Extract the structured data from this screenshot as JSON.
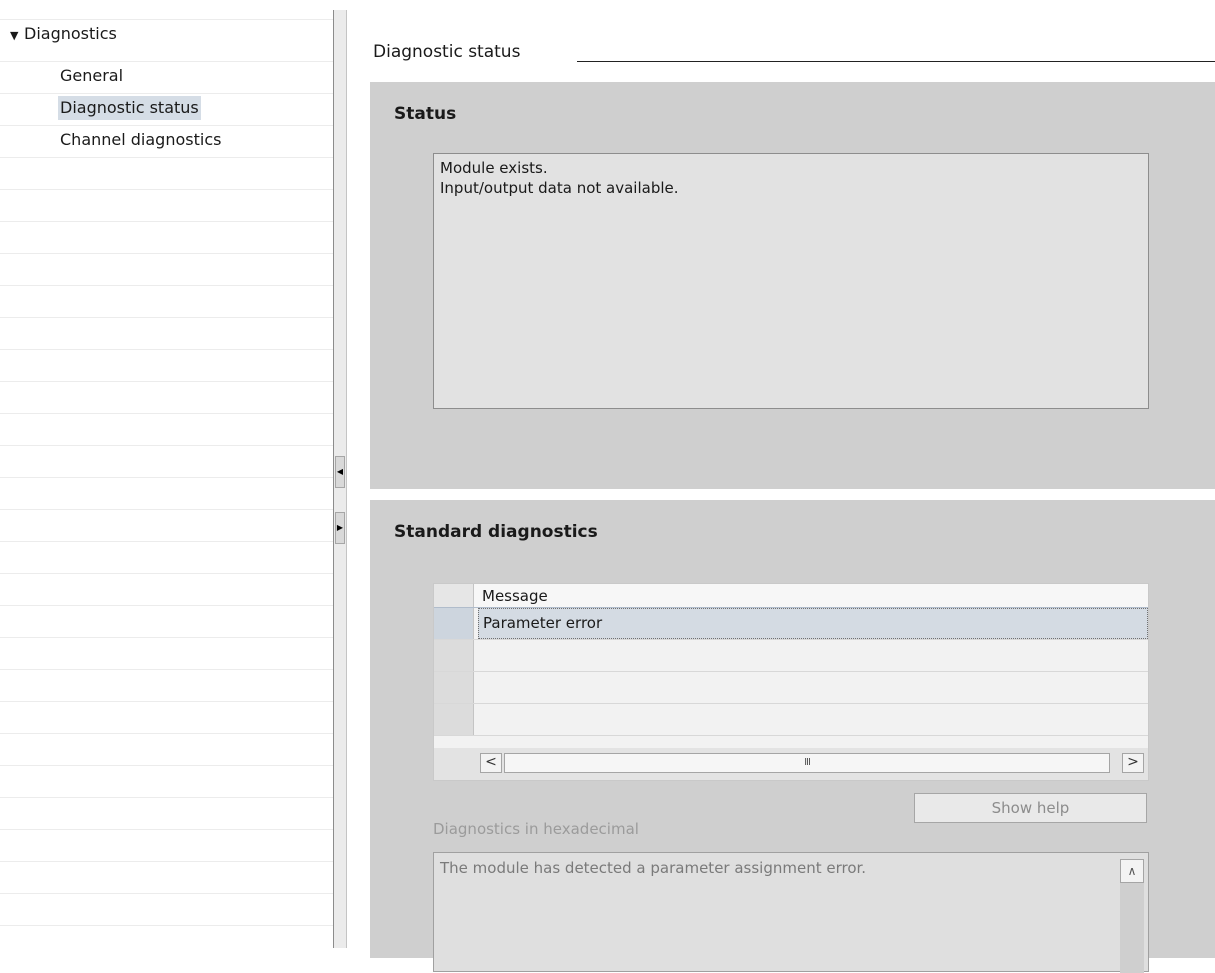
{
  "navigation": {
    "root_label": "Diagnostics",
    "items": [
      {
        "label": "General",
        "selected": false
      },
      {
        "label": "Diagnostic status",
        "selected": true
      },
      {
        "label": "Channel diagnostics",
        "selected": false
      }
    ]
  },
  "section": {
    "title": "Diagnostic status"
  },
  "status_panel": {
    "title": "Status",
    "lines": [
      "Module exists.",
      "Input/output data not available."
    ]
  },
  "standard_panel": {
    "title": "Standard diagnostics",
    "table": {
      "column_header": "Message",
      "rows": [
        "Parameter error",
        "",
        "",
        ""
      ]
    },
    "scroll_thumb_glyph": "III",
    "show_help_label": "Show help",
    "hex_label": "Diagnostics in hexadecimal",
    "hex_text": "The module has detected a parameter assignment error."
  },
  "icons": {
    "expand": "caret-down-icon",
    "collapse_left": "arrow-left-icon",
    "collapse_right": "arrow-right-icon",
    "scroll_left": "chevron-left-icon",
    "scroll_right": "chevron-right-icon",
    "scroll_up": "chevron-up-icon"
  },
  "colors": {
    "selection": "#d5dde6",
    "panel": "#cfcfcf"
  }
}
